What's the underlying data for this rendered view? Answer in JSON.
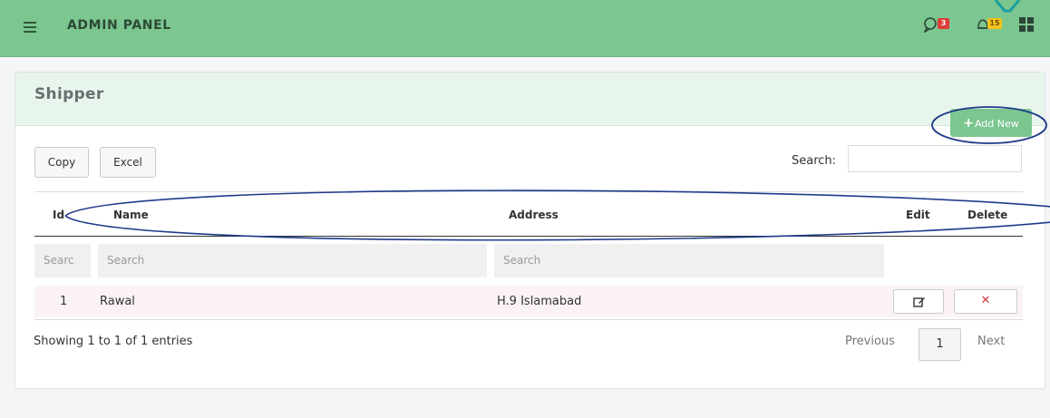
{
  "header": {
    "title": "ADMIN PANEL",
    "messages_badge": "3",
    "notifications_badge": "15"
  },
  "panel": {
    "title": "Shipper",
    "add_button_label": "Add New"
  },
  "toolbar": {
    "copy_label": "Copy",
    "excel_label": "Excel",
    "search_label": "Search:",
    "search_value": ""
  },
  "table": {
    "columns": [
      "Id",
      "Name",
      "Address",
      "Edit",
      "Delete"
    ],
    "filters": {
      "id_placeholder": "Searc",
      "name_placeholder": "Search",
      "address_placeholder": "Search"
    },
    "rows": [
      {
        "id": "1",
        "name": "Rawal",
        "address": "H.9 Islamabad"
      }
    ]
  },
  "footer": {
    "info": "Showing 1 to 1 of 1 entries",
    "previous_label": "Previous",
    "current_page": "1",
    "next_label": "Next"
  },
  "colors": {
    "header_bg": "#7cc690",
    "panel_head_bg": "#e8f5ec",
    "delete_icon": "#d9363e",
    "annotation": "#1f3a8a"
  },
  "icons": [
    "hamburger-icon",
    "chat-icon",
    "bell-icon",
    "apps-grid-icon",
    "plus-icon",
    "edit-icon",
    "close-icon"
  ]
}
